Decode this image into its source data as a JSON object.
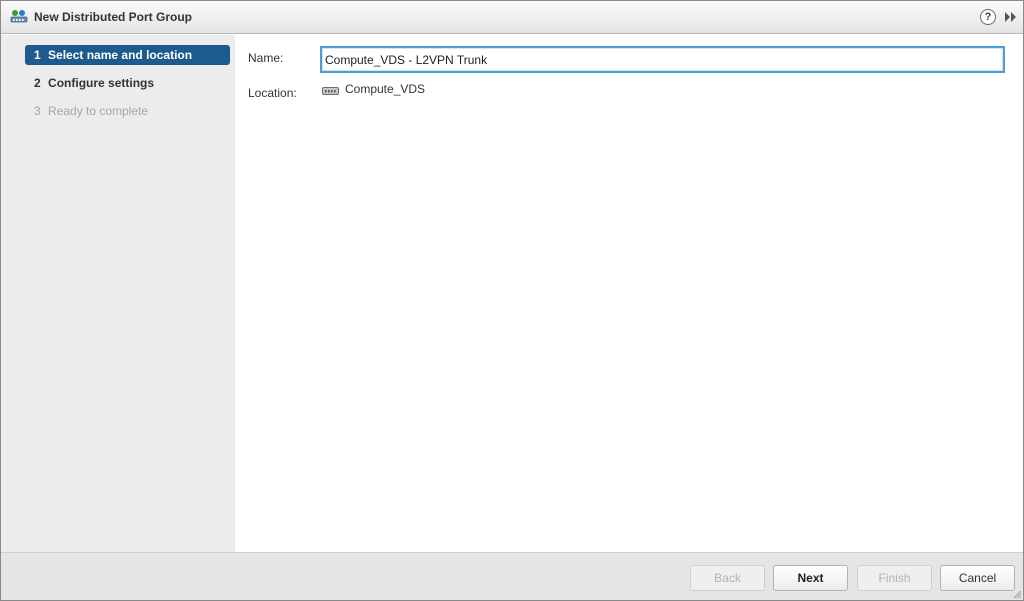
{
  "dialog": {
    "title": "New Distributed Port Group",
    "title_icon": "distributed-port-group-icon",
    "help_icon": "help-icon",
    "help_glyph": "?",
    "expand_icon": "expand-double-arrow-icon"
  },
  "steps": [
    {
      "number": "1",
      "label": "Select name and location",
      "state": "active"
    },
    {
      "number": "2",
      "label": "Configure settings",
      "state": "enabled"
    },
    {
      "number": "3",
      "label": "Ready to complete",
      "state": "disabled"
    }
  ],
  "form": {
    "name_label": "Name:",
    "name_value": "Compute_VDS - L2VPN Trunk",
    "location_label": "Location:",
    "location_value": "Compute_VDS",
    "location_icon": "distributed-switch-icon"
  },
  "footer": {
    "back_label": "Back",
    "next_label": "Next",
    "finish_label": "Finish",
    "cancel_label": "Cancel"
  },
  "colors": {
    "active_step": "#1d5b8e",
    "input_focus_border": "#4a9ed4",
    "sidebar_bg": "#ececec",
    "footer_bg": "#e5e5e5"
  }
}
